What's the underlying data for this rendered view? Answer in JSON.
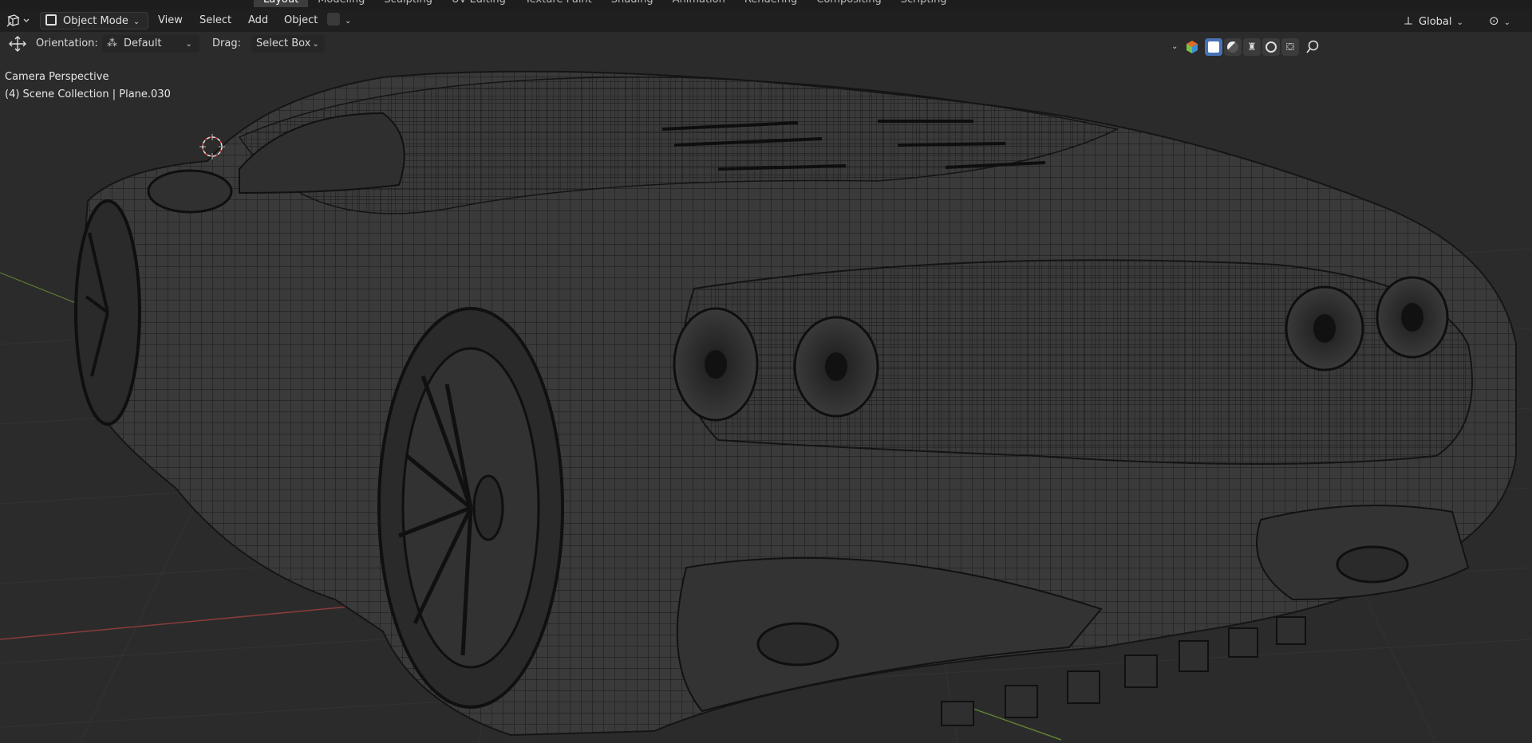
{
  "workspace_tabs": [
    "Layout",
    "Modeling",
    "Sculpting",
    "UV Editing",
    "Texture Paint",
    "Shading",
    "Animation",
    "Rendering",
    "Compositing",
    "Scripting"
  ],
  "workspace_active": "Layout",
  "header": {
    "editor_type_icon": "viewport-icon",
    "mode": "Object Mode",
    "menus": [
      "View",
      "Select",
      "Add",
      "Object"
    ],
    "transform_orientation": "Global"
  },
  "tool_settings": {
    "orientation_label": "Orientation:",
    "orientation_value": "Default",
    "drag_label": "Drag:",
    "drag_value": "Select Box"
  },
  "viewport": {
    "view_name": "Camera Perspective",
    "collection_info": "(4) Scene Collection | Plane.030",
    "shading_active": "wireframe"
  },
  "colors": {
    "header_bg": "#1f1f1f",
    "viewport_bg": "#2b2b2b",
    "accent_blue": "#4772b3",
    "x_axis": "#8a3b3b",
    "y_axis": "#5f7d33",
    "mesh": "#111111"
  }
}
